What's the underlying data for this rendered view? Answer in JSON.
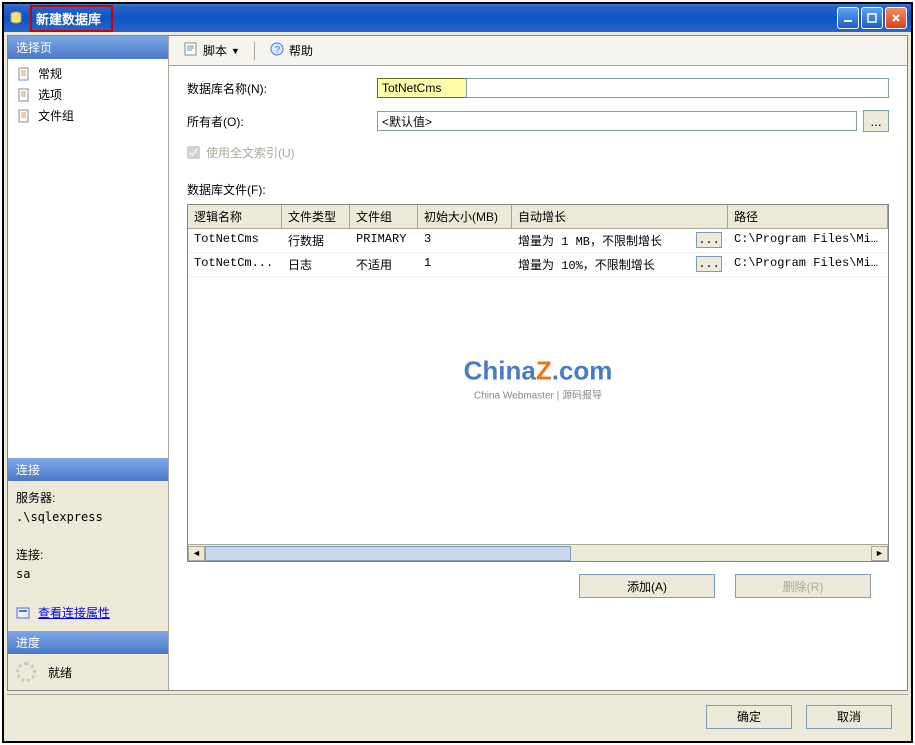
{
  "window": {
    "title": "新建数据库"
  },
  "left": {
    "sel_header": "选择页",
    "nav": [
      "常规",
      "选项",
      "文件组"
    ],
    "conn_header": "连接",
    "server_label": "服务器:",
    "server_value": ".\\sqlexpress",
    "conn_label": "连接:",
    "conn_value": "sa",
    "view_props": "查看连接属性",
    "progress_header": "进度",
    "progress_status": "就绪"
  },
  "toolbar": {
    "script": "脚本",
    "help": "帮助"
  },
  "form": {
    "dbname_label": "数据库名称(N):",
    "dbname_value": "TotNetCms",
    "owner_label": "所有者(O):",
    "owner_value": "<默认值>",
    "fulltext": "使用全文索引(U)",
    "files_label": "数据库文件(F):"
  },
  "grid": {
    "headers": [
      "逻辑名称",
      "文件类型",
      "文件组",
      "初始大小(MB)",
      "自动增长",
      "路径"
    ],
    "rows": [
      {
        "name": "TotNetCms",
        "type": "行数据",
        "group": "PRIMARY",
        "size": "3",
        "growth": "增量为 1 MB，不限制增长",
        "path": "C:\\Program Files\\Micro"
      },
      {
        "name": "TotNetCm...",
        "type": "日志",
        "group": "不适用",
        "size": "1",
        "growth": "增量为 10%，不限制增长",
        "path": "C:\\Program Files\\Micro"
      }
    ]
  },
  "buttons": {
    "add": "添加(A)",
    "remove": "删除(R)",
    "ok": "确定",
    "cancel": "取消"
  },
  "watermark": {
    "l1a": "China",
    "l1b": "Z",
    "l1c": ".com",
    "l2": "China Webmaster | 源码报导"
  }
}
